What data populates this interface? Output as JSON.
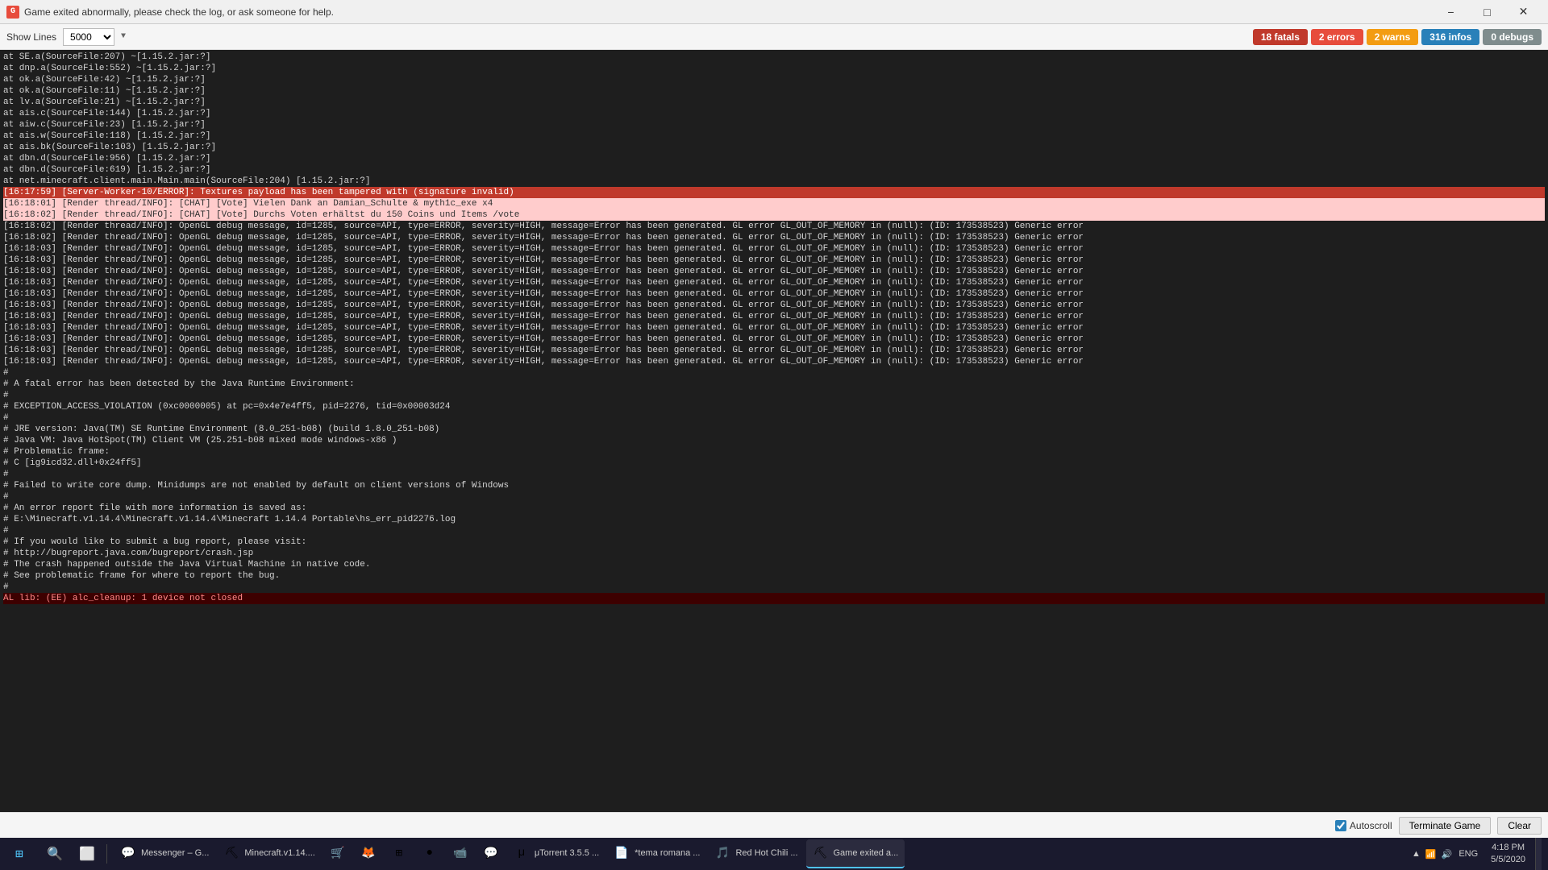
{
  "titleBar": {
    "icon": "G",
    "title": "Game exited abnormally, please check the log, or ask someone for help.",
    "minimize": "−",
    "maximize": "□",
    "close": "✕"
  },
  "toolbar": {
    "showLinesLabel": "Show Lines",
    "linesValue": "5000",
    "badges": {
      "fatals": "18 fatals",
      "errors": "2 errors",
      "warns": "2 warns",
      "infos": "316 infos",
      "debugs": "0 debugs"
    }
  },
  "logLines": [
    {
      "text": "\tat SE.a(SourceFile:207) ~[1.15.2.jar:?]",
      "type": "normal"
    },
    {
      "text": "\tat dnp.a(SourceFile:552) ~[1.15.2.jar:?]",
      "type": "normal"
    },
    {
      "text": "\tat ok.a(SourceFile:42) ~[1.15.2.jar:?]",
      "type": "normal"
    },
    {
      "text": "\tat ok.a(SourceFile:11) ~[1.15.2.jar:?]",
      "type": "normal"
    },
    {
      "text": "\tat lv.a(SourceFile:21) ~[1.15.2.jar:?]",
      "type": "normal"
    },
    {
      "text": "\tat ais.c(SourceFile:144) [1.15.2.jar:?]",
      "type": "normal"
    },
    {
      "text": "\tat aiw.c(SourceFile:23) [1.15.2.jar:?]",
      "type": "normal"
    },
    {
      "text": "\tat ais.w(SourceFile:118) [1.15.2.jar:?]",
      "type": "normal"
    },
    {
      "text": "\tat ais.bk(SourceFile:103) [1.15.2.jar:?]",
      "type": "normal"
    },
    {
      "text": "\tat dbn.d(SourceFile:956) [1.15.2.jar:?]",
      "type": "normal"
    },
    {
      "text": "\tat dbn.d(SourceFile:619) [1.15.2.jar:?]",
      "type": "normal"
    },
    {
      "text": "\tat net.minecraft.client.main.Main.main(SourceFile:204) [1.15.2.jar:?]",
      "type": "normal"
    },
    {
      "text": "[16:17:59] [Server-Worker-10/ERROR]: Textures payload has been tampered with (signature invalid)",
      "type": "highlight-red"
    },
    {
      "text": "[16:18:01] [Render thread/INFO]: [CHAT] [Vote] Vielen Dank an Damian_Schulte & myth1c_exe x4",
      "type": "highlight-pink"
    },
    {
      "text": "[16:18:02] [Render thread/INFO]: [CHAT] [Vote] Durchs Voten erhältst du 150 Coins und Items /vote",
      "type": "highlight-pink"
    },
    {
      "text": "[16:18:02] [Render thread/INFO]: OpenGL debug message, id=1285, source=API, type=ERROR, severity=HIGH, message=Error has been generated. GL error GL_OUT_OF_MEMORY in (null): (ID: 173538523) Generic error",
      "type": "normal"
    },
    {
      "text": "[16:18:02] [Render thread/INFO]: OpenGL debug message, id=1285, source=API, type=ERROR, severity=HIGH, message=Error has been generated. GL error GL_OUT_OF_MEMORY in (null): (ID: 173538523) Generic error",
      "type": "normal"
    },
    {
      "text": "[16:18:03] [Render thread/INFO]: OpenGL debug message, id=1285, source=API, type=ERROR, severity=HIGH, message=Error has been generated. GL error GL_OUT_OF_MEMORY in (null): (ID: 173538523) Generic error",
      "type": "normal"
    },
    {
      "text": "[16:18:03] [Render thread/INFO]: OpenGL debug message, id=1285, source=API, type=ERROR, severity=HIGH, message=Error has been generated. GL error GL_OUT_OF_MEMORY in (null): (ID: 173538523) Generic error",
      "type": "normal"
    },
    {
      "text": "[16:18:03] [Render thread/INFO]: OpenGL debug message, id=1285, source=API, type=ERROR, severity=HIGH, message=Error has been generated. GL error GL_OUT_OF_MEMORY in (null): (ID: 173538523) Generic error",
      "type": "normal"
    },
    {
      "text": "[16:18:03] [Render thread/INFO]: OpenGL debug message, id=1285, source=API, type=ERROR, severity=HIGH, message=Error has been generated. GL error GL_OUT_OF_MEMORY in (null): (ID: 173538523) Generic error",
      "type": "normal"
    },
    {
      "text": "[16:18:03] [Render thread/INFO]: OpenGL debug message, id=1285, source=API, type=ERROR, severity=HIGH, message=Error has been generated. GL error GL_OUT_OF_MEMORY in (null): (ID: 173538523) Generic error",
      "type": "normal"
    },
    {
      "text": "[16:18:03] [Render thread/INFO]: OpenGL debug message, id=1285, source=API, type=ERROR, severity=HIGH, message=Error has been generated. GL error GL_OUT_OF_MEMORY in (null): (ID: 173538523) Generic error",
      "type": "normal"
    },
    {
      "text": "[16:18:03] [Render thread/INFO]: OpenGL debug message, id=1285, source=API, type=ERROR, severity=HIGH, message=Error has been generated. GL error GL_OUT_OF_MEMORY in (null): (ID: 173538523) Generic error",
      "type": "normal"
    },
    {
      "text": "[16:18:03] [Render thread/INFO]: OpenGL debug message, id=1285, source=API, type=ERROR, severity=HIGH, message=Error has been generated. GL error GL_OUT_OF_MEMORY in (null): (ID: 173538523) Generic error",
      "type": "normal"
    },
    {
      "text": "[16:18:03] [Render thread/INFO]: OpenGL debug message, id=1285, source=API, type=ERROR, severity=HIGH, message=Error has been generated. GL error GL_OUT_OF_MEMORY in (null): (ID: 173538523) Generic error",
      "type": "normal"
    },
    {
      "text": "[16:18:03] [Render thread/INFO]: OpenGL debug message, id=1285, source=API, type=ERROR, severity=HIGH, message=Error has been generated. GL error GL_OUT_OF_MEMORY in (null): (ID: 173538523) Generic error",
      "type": "normal"
    },
    {
      "text": "[16:18:03] [Render thread/INFO]: OpenGL debug message, id=1285, source=API, type=ERROR, severity=HIGH, message=Error has been generated. GL error GL_OUT_OF_MEMORY in (null): (ID: 173538523) Generic error",
      "type": "normal"
    },
    {
      "text": "#",
      "type": "normal"
    },
    {
      "text": "# A fatal error has been detected by the Java Runtime Environment:",
      "type": "normal"
    },
    {
      "text": "#",
      "type": "normal"
    },
    {
      "text": "#  EXCEPTION_ACCESS_VIOLATION (0xc0000005) at pc=0x4e7e4ff5, pid=2276, tid=0x00003d24",
      "type": "normal"
    },
    {
      "text": "#",
      "type": "normal"
    },
    {
      "text": "# JRE version: Java(TM) SE Runtime Environment (8.0_251-b08) (build 1.8.0_251-b08)",
      "type": "normal"
    },
    {
      "text": "# Java VM: Java HotSpot(TM) Client VM (25.251-b08 mixed mode windows-x86 )",
      "type": "normal"
    },
    {
      "text": "# Problematic frame:",
      "type": "normal"
    },
    {
      "text": "# C  [ig9icd32.dll+0x24ff5]",
      "type": "normal"
    },
    {
      "text": "#",
      "type": "normal"
    },
    {
      "text": "# Failed to write core dump. Minidumps are not enabled by default on client versions of Windows",
      "type": "normal"
    },
    {
      "text": "#",
      "type": "normal"
    },
    {
      "text": "# An error report file with more information is saved as:",
      "type": "normal"
    },
    {
      "text": "# E:\\Minecraft.v1.14.4\\Minecraft.v1.14.4\\Minecraft 1.14.4 Portable\\hs_err_pid2276.log",
      "type": "normal"
    },
    {
      "text": "#",
      "type": "normal"
    },
    {
      "text": "# If you would like to submit a bug report, please visit:",
      "type": "normal"
    },
    {
      "text": "#   http://bugreport.java.com/bugreport/crash.jsp",
      "type": "normal"
    },
    {
      "text": "# The crash happened outside the Java Virtual Machine in native code.",
      "type": "normal"
    },
    {
      "text": "# See problematic frame for where to report the bug.",
      "type": "normal"
    },
    {
      "text": "#",
      "type": "normal"
    },
    {
      "text": "AL lib: (EE) alc_cleanup: 1 device not closed",
      "type": "fatal-error"
    }
  ],
  "bottomBar": {
    "autoscrollLabel": "Autoscroll",
    "terminateLabel": "Terminate Game",
    "clearLabel": "Clear"
  },
  "taskbar": {
    "time": "4:18 PM",
    "date": "5/5/2020",
    "lang": "ENG",
    "apps": [
      {
        "label": "Messenger – G...",
        "icon": "💬",
        "active": false
      },
      {
        "label": "Minecraft.v1.14....",
        "icon": "⛏",
        "active": false
      },
      {
        "label": "",
        "icon": "🛒",
        "active": false
      },
      {
        "label": "",
        "icon": "🦊",
        "active": false
      },
      {
        "label": "",
        "icon": "⊞",
        "active": false
      },
      {
        "label": "",
        "icon": "●",
        "active": false
      },
      {
        "label": "",
        "icon": "📹",
        "active": false
      },
      {
        "label": "",
        "icon": "💬",
        "active": false
      },
      {
        "label": "μTorrent 3.5.5 ...",
        "icon": "µ",
        "active": false
      },
      {
        "label": "*tema romana ...",
        "icon": "📄",
        "active": false
      },
      {
        "label": "Red Hot Chili ...",
        "icon": "🎵",
        "active": false
      },
      {
        "label": "Game exited a...",
        "icon": "⛏",
        "active": true
      }
    ]
  }
}
